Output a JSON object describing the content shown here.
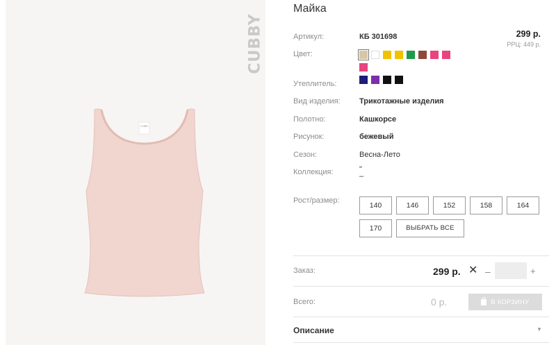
{
  "brand": "CUBBY",
  "tag_label": "CUBBY",
  "product": {
    "title": "Майка",
    "article_label": "Артикул:",
    "article": "КБ 301698",
    "price": "299 р.",
    "rrp": "РРЦ: 449 р.",
    "color_label": "Цвет:",
    "colors": [
      "#d9c6a8",
      "#ffffff",
      "#f2c200",
      "#f2c200",
      "#1e9a4a",
      "#8b4a3a",
      "#e8447f",
      "#e8447f",
      "#e8447f",
      "#1d1c7a",
      "#7b2fa8",
      "#111111",
      "#111111"
    ],
    "selected_color_index": 0,
    "insulation_label": "Утеплитель:",
    "insulation": "\"",
    "type_label": "Вид изделия:",
    "type": "Трикотажные изделия",
    "fabric_label": "Полотно:",
    "fabric": "Кашкорсе",
    "pattern_label": "Рисунок:",
    "pattern": "бежевый",
    "season_label": "Сезон:",
    "season": "Весна-Лето",
    "collection_label": "Коллекция:",
    "collection": "\"",
    "collection_sub": "–",
    "size_label": "Рост/размер:",
    "sizes": [
      "140",
      "146",
      "152",
      "158",
      "164",
      "170"
    ],
    "select_all": "ВЫБРАТЬ ВСЕ"
  },
  "order": {
    "label": "Заказ:",
    "price": "299 р.",
    "remove_symbol": "✕",
    "minus": "–",
    "qty": "",
    "plus": "+",
    "total_label": "Всего:",
    "total": "0 р.",
    "cart_button": "В КОРЗИНУ"
  },
  "description": {
    "label": "Описание",
    "arrow": "▼"
  }
}
